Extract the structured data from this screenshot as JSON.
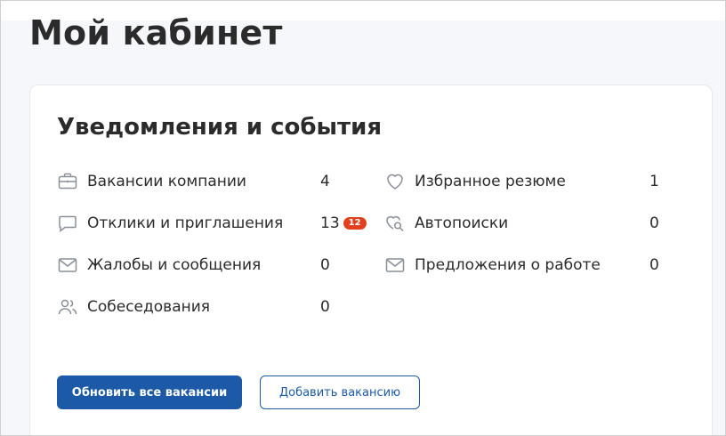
{
  "page": {
    "title": "Мой кабинет"
  },
  "card": {
    "title": "Уведомления и события",
    "left": [
      {
        "icon": "briefcase-icon",
        "label": "Вакансии компании",
        "count": "4"
      },
      {
        "icon": "chat-bubble-icon",
        "label": "Отклики и приглашения",
        "count": "13",
        "badge": "12"
      },
      {
        "icon": "envelope-icon",
        "label": "Жалобы и сообщения",
        "count": "0"
      },
      {
        "icon": "people-icon",
        "label": "Собеседования",
        "count": "0"
      }
    ],
    "right": [
      {
        "icon": "heart-icon",
        "label": "Избранное резюме",
        "count": "1"
      },
      {
        "icon": "heart-search-icon",
        "label": "Автопоиски",
        "count": "0"
      },
      {
        "icon": "envelope-icon",
        "label": "Предложения о работе",
        "count": "0"
      }
    ],
    "buttons": {
      "update_label": "Обновить все вакансии",
      "add_label": "Добавить вакансию"
    }
  },
  "colors": {
    "primary": "#1c5aa8",
    "badge": "#e0401e",
    "icon": "#8a8f99"
  }
}
